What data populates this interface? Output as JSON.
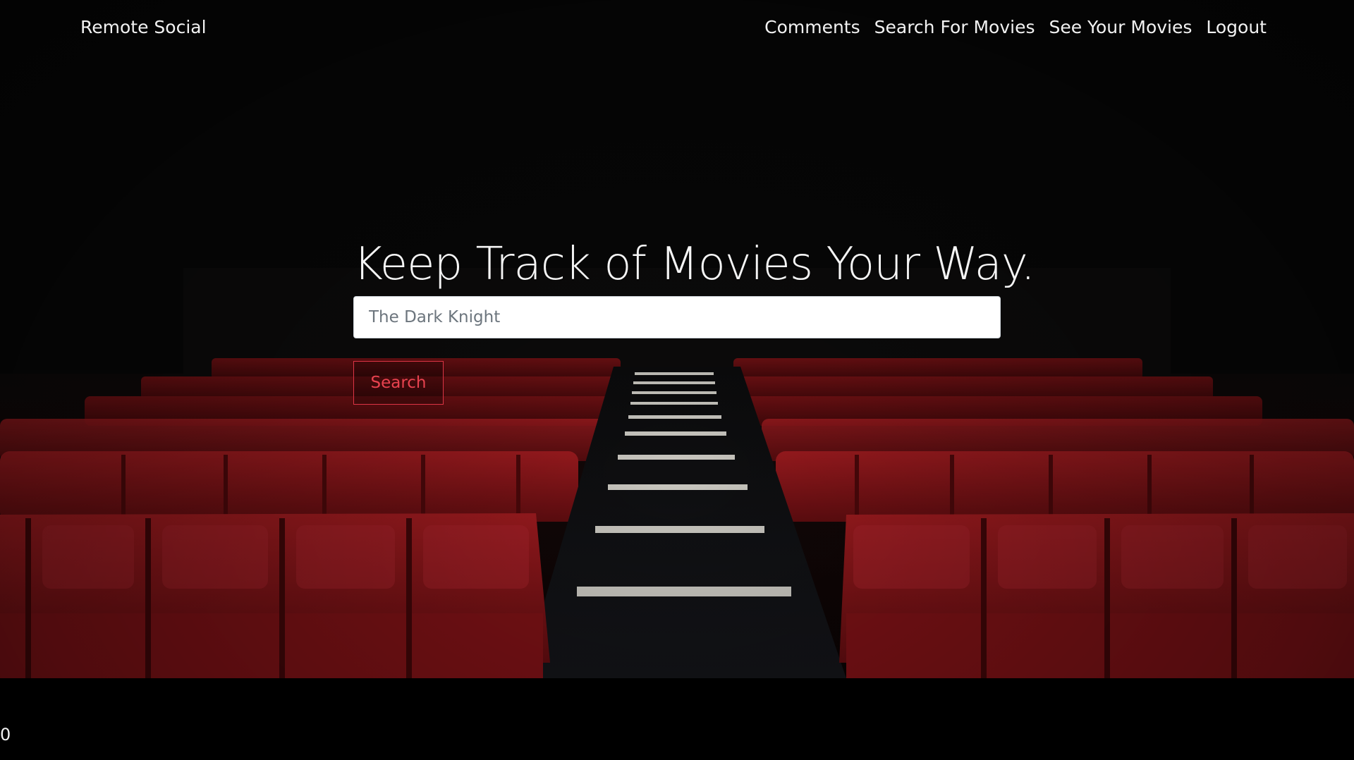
{
  "navbar": {
    "brand": "Remote Social",
    "links": [
      {
        "label": "Comments"
      },
      {
        "label": "Search For Movies"
      },
      {
        "label": "See Your Movies"
      },
      {
        "label": "Logout"
      }
    ]
  },
  "hero": {
    "title": "Keep Track of Movies Your Way.",
    "search": {
      "placeholder": "The Dark Knight",
      "value": ""
    },
    "search_button_label": "Search",
    "background": "cinema-seats-image"
  },
  "footer": {
    "counter": "0"
  },
  "colors": {
    "page_background": "#000000",
    "accent": "#dc3545",
    "seat_red": "#8e1418",
    "nav_text": "#f2f2f2"
  }
}
